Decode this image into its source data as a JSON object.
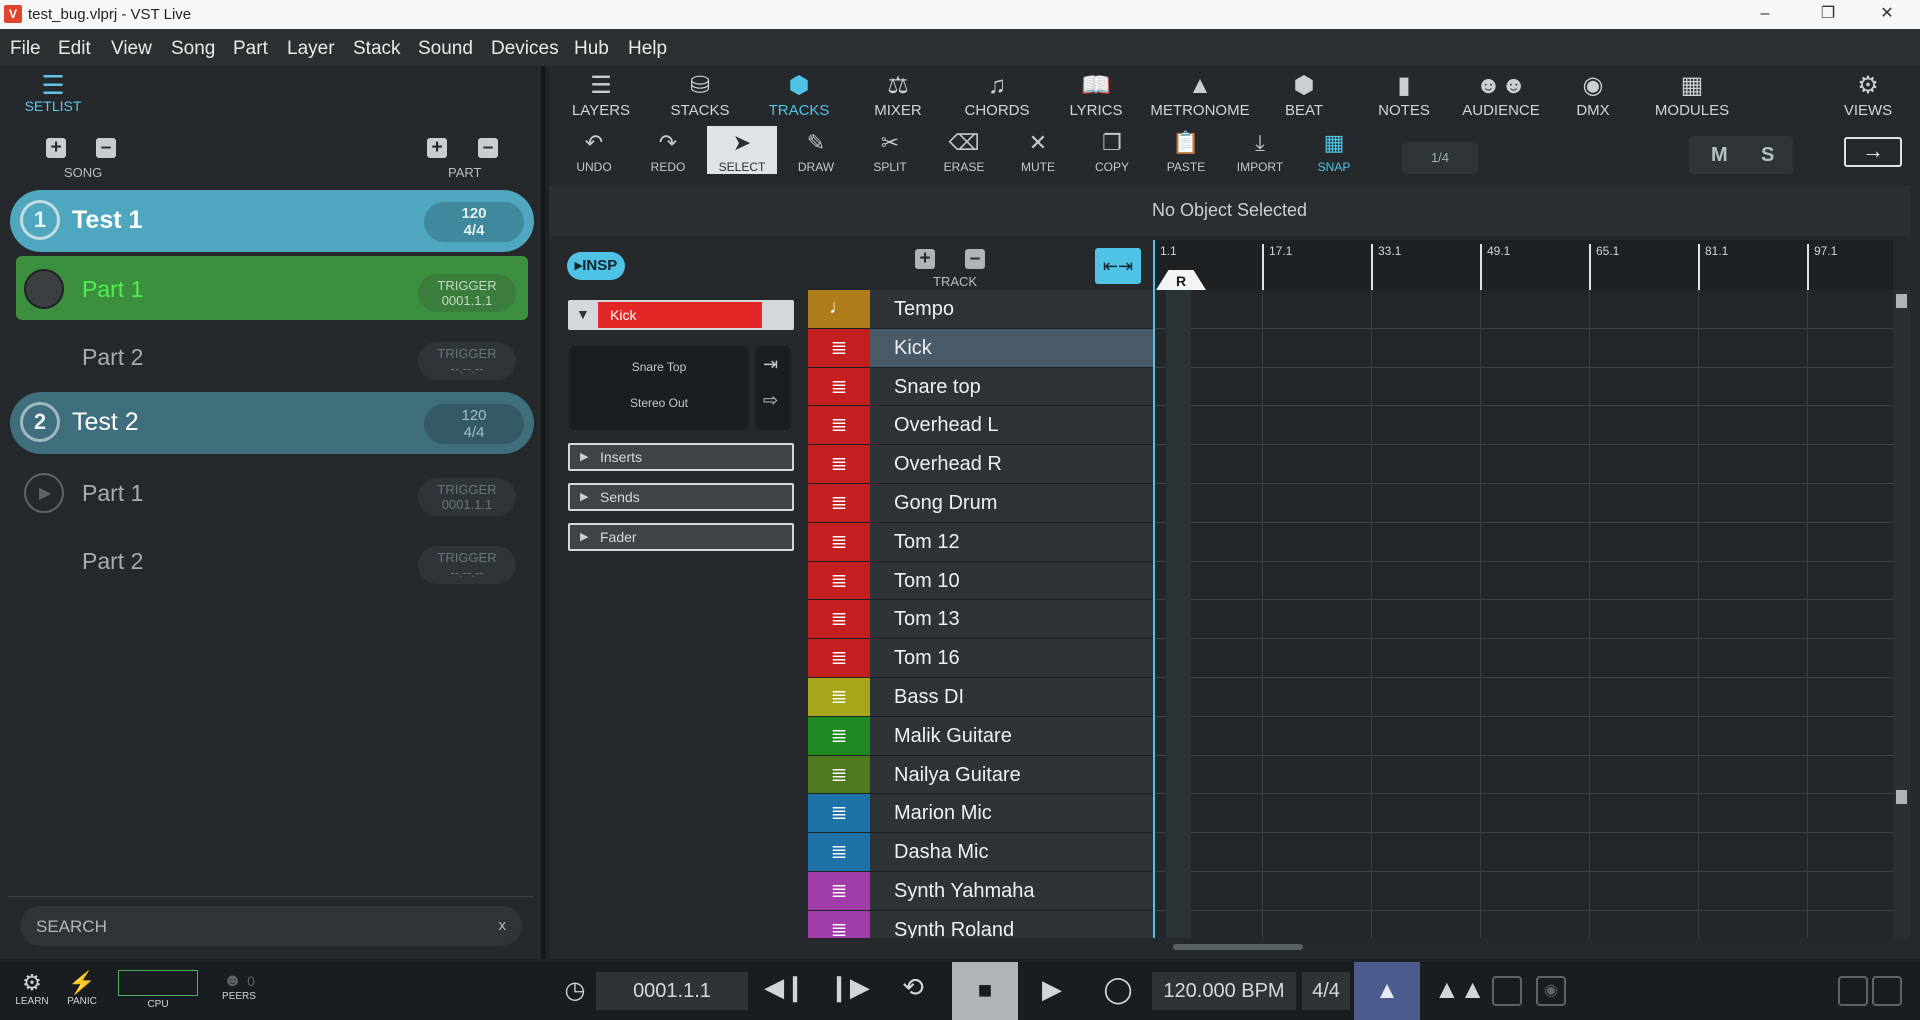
{
  "window": {
    "title": "test_bug.vlprj - VST Live",
    "app_icon": "V"
  },
  "menu": [
    "File",
    "Edit",
    "View",
    "Song",
    "Part",
    "Layer",
    "Stack",
    "Sound",
    "Devices",
    "Hub",
    "Help"
  ],
  "setlist": {
    "tab_label": "SETLIST",
    "song_label": "SONG",
    "part_label": "PART",
    "songs": [
      {
        "num": "1",
        "name": "Test 1",
        "tempo": "120",
        "sig": "4/4"
      },
      {
        "num": "2",
        "name": "Test 2",
        "tempo": "120",
        "sig": "4/4"
      }
    ],
    "parts": [
      {
        "name": "Part 1",
        "trigger": "TRIGGER",
        "pos": "0001.1.1"
      },
      {
        "name": "Part 2",
        "trigger": "TRIGGER",
        "pos": "--.--.--"
      },
      {
        "name": "Part 1",
        "trigger": "TRIGGER",
        "pos": "0001.1.1"
      },
      {
        "name": "Part 2",
        "trigger": "TRIGGER",
        "pos": "--.--.--"
      }
    ],
    "search_placeholder": "SEARCH",
    "search_clear": "x"
  },
  "toolbar_top": [
    "LAYERS",
    "STACKS",
    "TRACKS",
    "MIXER",
    "CHORDS",
    "LYRICS",
    "METRONOME",
    "BEAT",
    "NOTES",
    "AUDIENCE",
    "DMX",
    "MODULES",
    "VIEWS"
  ],
  "toolbar_edit": [
    "UNDO",
    "REDO",
    "SELECT",
    "DRAW",
    "SPLIT",
    "ERASE",
    "MUTE",
    "COPY",
    "PASTE",
    "IMPORT",
    "SNAP"
  ],
  "quantize": "1/4",
  "mute_label": "M",
  "solo_label": "S",
  "status_text": "No Object Selected",
  "inspector": {
    "button": "INSP",
    "track_name": "Kick",
    "input": "Snare Top",
    "output": "Stereo Out",
    "sections": [
      "Inserts",
      "Sends",
      "Fader"
    ]
  },
  "track_header_label": "TRACK",
  "tracks": [
    {
      "name": "Tempo",
      "color": "#b07d1c",
      "icon": "note"
    },
    {
      "name": "Kick",
      "color": "#c41f1f",
      "icon": "wave"
    },
    {
      "name": "Snare top",
      "color": "#c41f1f",
      "icon": "wave"
    },
    {
      "name": "Overhead L",
      "color": "#c41f1f",
      "icon": "wave"
    },
    {
      "name": "Overhead R",
      "color": "#c41f1f",
      "icon": "wave"
    },
    {
      "name": "Gong Drum",
      "color": "#c41f1f",
      "icon": "wave"
    },
    {
      "name": "Tom 12",
      "color": "#c41f1f",
      "icon": "wave"
    },
    {
      "name": "Tom 10",
      "color": "#c41f1f",
      "icon": "wave"
    },
    {
      "name": "Tom 13",
      "color": "#c41f1f",
      "icon": "wave"
    },
    {
      "name": "Tom 16",
      "color": "#c41f1f",
      "icon": "wave"
    },
    {
      "name": "Bass DI",
      "color": "#a9a51b",
      "icon": "wave"
    },
    {
      "name": "Malik Guitare",
      "color": "#1f8a22",
      "icon": "wave"
    },
    {
      "name": "Nailya Guitare",
      "color": "#4e7a1d",
      "icon": "wave"
    },
    {
      "name": "Marion Mic",
      "color": "#1d73a8",
      "icon": "wave"
    },
    {
      "name": "Dasha Mic",
      "color": "#1d73a8",
      "icon": "wave"
    },
    {
      "name": "Synth Yahmaha",
      "color": "#a13da8",
      "icon": "wave"
    },
    {
      "name": "Synth Roland",
      "color": "#a13da8",
      "icon": "wave"
    }
  ],
  "ruler_marks": [
    "1.1",
    "17.1",
    "33.1",
    "49.1",
    "65.1",
    "81.1",
    "97.1"
  ],
  "locator_label": "R",
  "transport": {
    "learn": "LEARN",
    "panic": "PANIC",
    "cpu": "CPU",
    "peers": "PEERS",
    "peers_count": "0",
    "position": "0001.1.1",
    "bpm": "120.000 BPM",
    "signature": "4/4"
  }
}
